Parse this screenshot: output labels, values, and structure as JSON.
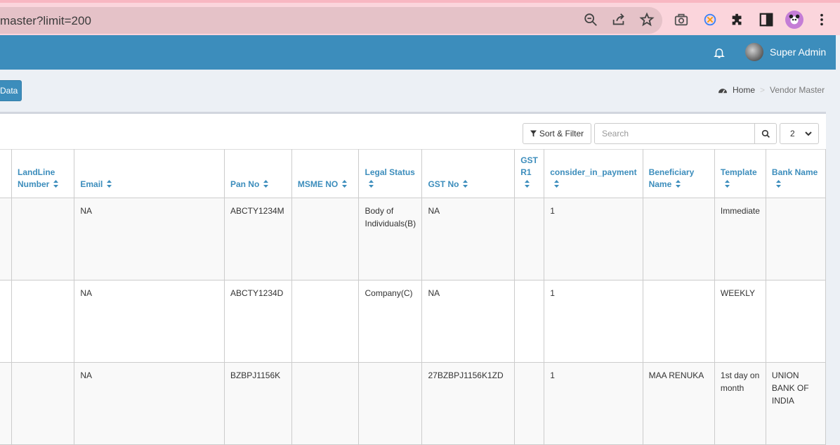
{
  "browser": {
    "url": "master?limit=200"
  },
  "header": {
    "user_name": "Super Admin"
  },
  "content_header": {
    "button_label": "Data",
    "breadcrumb": [
      "Home",
      "Vendor Master"
    ]
  },
  "toolbar": {
    "sort_filter_label": "Sort & Filter",
    "search_placeholder": "Search",
    "page_size": "2"
  },
  "table": {
    "columns": [
      {
        "label": "",
        "lines": []
      },
      {
        "label": "LandLine Number",
        "lines": [
          "LandLine",
          "Number"
        ]
      },
      {
        "label": "Email",
        "lines": [
          "Email"
        ]
      },
      {
        "label": "Pan No",
        "lines": [
          "Pan No"
        ]
      },
      {
        "label": "MSME NO",
        "lines": [
          "MSME NO"
        ]
      },
      {
        "label": "Legal Status",
        "lines": [
          "Legal Status",
          ""
        ]
      },
      {
        "label": "GST No",
        "lines": [
          "GST No"
        ]
      },
      {
        "label": "GST R1",
        "lines": [
          "GST",
          "R1",
          ""
        ]
      },
      {
        "label": "consider_in_payment",
        "lines": [
          "consider_in_payment",
          ""
        ]
      },
      {
        "label": "Beneficiary Name",
        "lines": [
          "Beneficiary",
          "Name"
        ]
      },
      {
        "label": "Template",
        "lines": [
          "Template",
          ""
        ]
      },
      {
        "label": "Bank Name",
        "lines": [
          "Bank Name",
          ""
        ]
      }
    ],
    "rows": [
      [
        "",
        "",
        "NA",
        "ABCTY1234M",
        "",
        "Body of Individuals(B)",
        "NA",
        "",
        "1",
        "",
        "Immediate",
        ""
      ],
      [
        "",
        "",
        "NA",
        "ABCTY1234D",
        "",
        "Company(C)",
        "NA",
        "",
        "1",
        "",
        "WEEKLY",
        ""
      ],
      [
        "",
        "",
        "NA",
        "BZBPJ1156K",
        "",
        "",
        "27BZBPJ1156K1ZD",
        "",
        "1",
        "MAA RENUKA",
        "1st day on month",
        "UNION BANK OF INDIA"
      ]
    ]
  },
  "colors": {
    "primary": "#3c8dbc",
    "browser_bar": "#fbd5dc",
    "address_bar": "#e5c2c8",
    "content_bg": "#ecf0f5"
  }
}
